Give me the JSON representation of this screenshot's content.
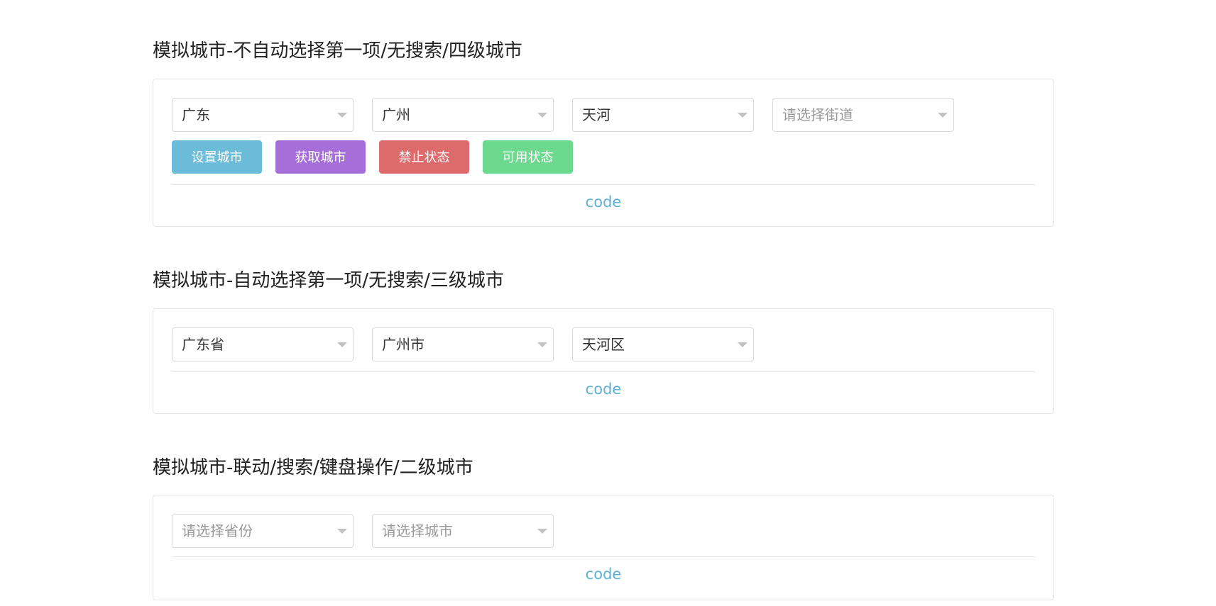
{
  "sections": [
    {
      "title": "模拟城市-不自动选择第一项/无搜索/四级城市",
      "selects": [
        {
          "value": "广东",
          "placeholder": false
        },
        {
          "value": "广州",
          "placeholder": false
        },
        {
          "value": "天河",
          "placeholder": false
        },
        {
          "value": "请选择街道",
          "placeholder": true
        }
      ],
      "buttons": [
        {
          "label": "设置城市",
          "color": "#6bbcd9"
        },
        {
          "label": "获取城市",
          "color": "#a66ed9"
        },
        {
          "label": "禁止状态",
          "color": "#dd6b6b"
        },
        {
          "label": "可用状态",
          "color": "#6dd98f"
        }
      ],
      "code_label": "code"
    },
    {
      "title": "模拟城市-自动选择第一项/无搜索/三级城市",
      "selects": [
        {
          "value": "广东省",
          "placeholder": false
        },
        {
          "value": "广州市",
          "placeholder": false
        },
        {
          "value": "天河区",
          "placeholder": false
        }
      ],
      "code_label": "code"
    },
    {
      "title": "模拟城市-联动/搜索/键盘操作/二级城市",
      "selects": [
        {
          "value": "请选择省份",
          "placeholder": true
        },
        {
          "value": "请选择城市",
          "placeholder": true
        }
      ],
      "code_label": "code"
    }
  ],
  "icons": {
    "caret": "caret-down-icon"
  }
}
